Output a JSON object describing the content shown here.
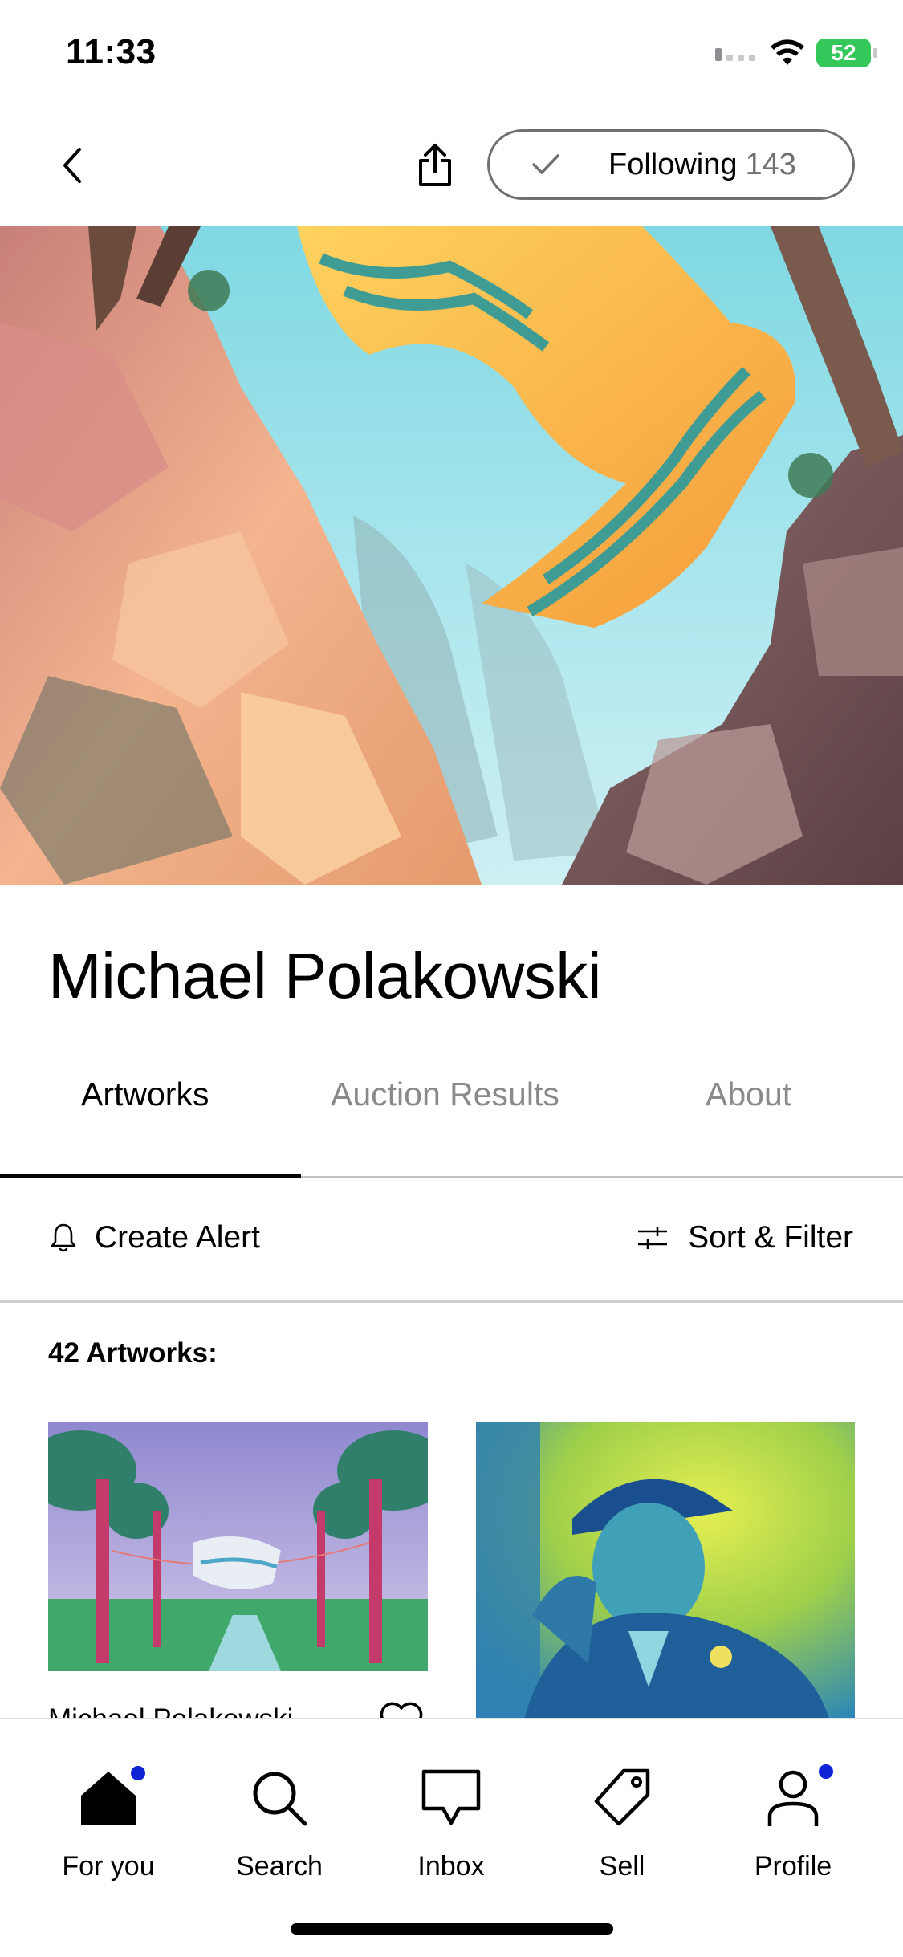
{
  "status": {
    "time": "11:33",
    "battery": "52"
  },
  "header": {
    "follow_label": "Following",
    "follow_count": "143"
  },
  "artist": {
    "name": "Michael Polakowski"
  },
  "tabs": [
    {
      "label": "Artworks",
      "active": true
    },
    {
      "label": "Auction Results",
      "active": false
    },
    {
      "label": "About",
      "active": false
    }
  ],
  "actions": {
    "create_alert": "Create Alert",
    "sort_filter": "Sort & Filter"
  },
  "artworks": {
    "count_label": "42 Artworks:",
    "items": [
      {
        "artist": "Michael Polakowski"
      },
      {
        "artist": ""
      }
    ]
  },
  "bottom_nav": [
    {
      "label": "For you",
      "icon": "home-icon",
      "badge": true
    },
    {
      "label": "Search",
      "icon": "search-icon",
      "badge": false
    },
    {
      "label": "Inbox",
      "icon": "inbox-icon",
      "badge": false
    },
    {
      "label": "Sell",
      "icon": "tag-icon",
      "badge": false
    },
    {
      "label": "Profile",
      "icon": "profile-icon",
      "badge": true
    }
  ],
  "colors": {
    "accent_badge": "#1023d7",
    "battery": "#34c759"
  }
}
